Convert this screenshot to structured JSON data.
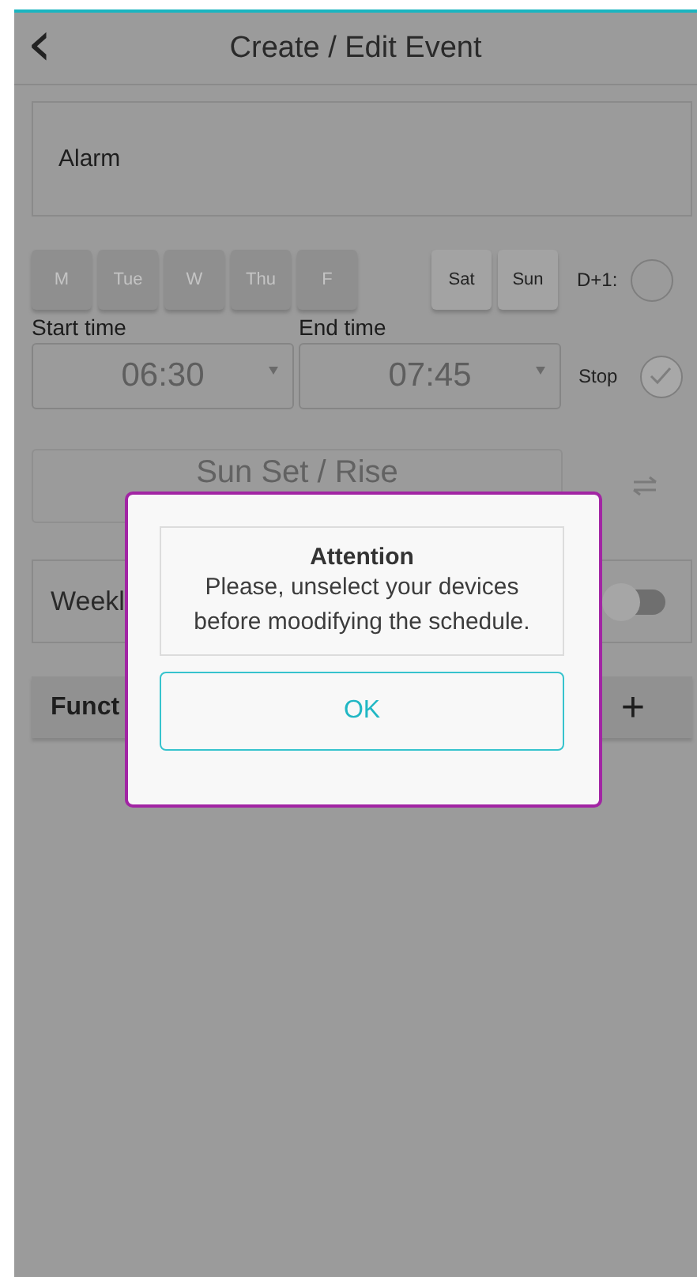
{
  "header": {
    "back": "‹",
    "title": "Create / Edit Event"
  },
  "name_field": {
    "value": "Alarm"
  },
  "days": [
    {
      "label": "M",
      "selected": false
    },
    {
      "label": "Tue",
      "selected": false
    },
    {
      "label": "W",
      "selected": false
    },
    {
      "label": "Thu",
      "selected": false
    },
    {
      "label": "F",
      "selected": false
    },
    {
      "label": "Sat",
      "selected": true
    },
    {
      "label": "Sun",
      "selected": true
    }
  ],
  "next_day": {
    "label": "D+1:",
    "checked": false
  },
  "start_time": {
    "label": "Start time",
    "value": "06:30"
  },
  "end_time": {
    "label": "End time",
    "value": "07:45"
  },
  "stop": {
    "label": "Stop",
    "checked": true
  },
  "sun_field": {
    "placeholder": "Sun Set / Rise"
  },
  "weekly": {
    "label": "Weekl",
    "on": false
  },
  "functions": {
    "label": "Funct",
    "add": "+"
  },
  "dialog": {
    "title": "Attention",
    "message": "Please, unselect your devices before moodifying the schedule.",
    "button": "OK"
  }
}
